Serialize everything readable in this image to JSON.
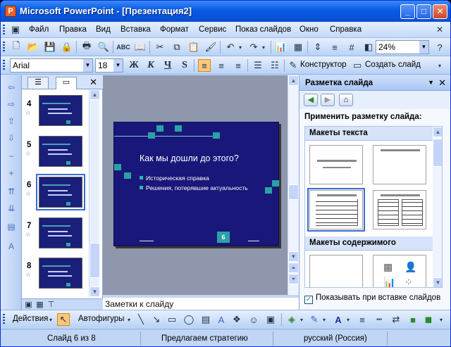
{
  "window": {
    "title": "Microsoft PowerPoint - [Презентация2]",
    "app_icon": "P"
  },
  "menu": [
    "Файл",
    "Правка",
    "Вид",
    "Вставка",
    "Формат",
    "Сервис",
    "Показ слайдов",
    "Окно",
    "Справка"
  ],
  "toolbar": {
    "zoom": "24%",
    "font_name": "Arial",
    "font_size": "18",
    "bold": "Ж",
    "italic": "К",
    "underline": "Ч",
    "shadow": "S",
    "designer_label": "Конструктор",
    "new_slide_label": "Создать слайд"
  },
  "thumbnails": {
    "slides": [
      {
        "num": "4",
        "selected": false
      },
      {
        "num": "5",
        "selected": false
      },
      {
        "num": "6",
        "selected": true
      },
      {
        "num": "7",
        "selected": false
      },
      {
        "num": "8",
        "selected": false
      }
    ]
  },
  "slide": {
    "title": "Как мы дошли до этого?",
    "bullets": [
      "Историческая справка",
      "Решения, потерявшие актуальность"
    ],
    "number": "6"
  },
  "notes": {
    "placeholder": "Заметки к слайду"
  },
  "taskpane": {
    "title": "Разметка слайда",
    "apply_label": "Применить разметку слайда:",
    "group_text": "Макеты текста",
    "group_content": "Макеты содержимого",
    "show_on_insert": "Показывать при вставке слайдов",
    "show_on_insert_checked": true
  },
  "drawbar": {
    "actions": "Действия",
    "autoshapes": "Автофигуры"
  },
  "status": {
    "slide": "Слайд 6 из 8",
    "design": "Предлагаем стратегию",
    "language": "русский (Россия)"
  },
  "colors": {
    "title_bar": "#0a5ee6",
    "slide_bg": "#19177a",
    "slide_accent": "#2aa2a4",
    "pane_bg": "#c3daf9"
  }
}
